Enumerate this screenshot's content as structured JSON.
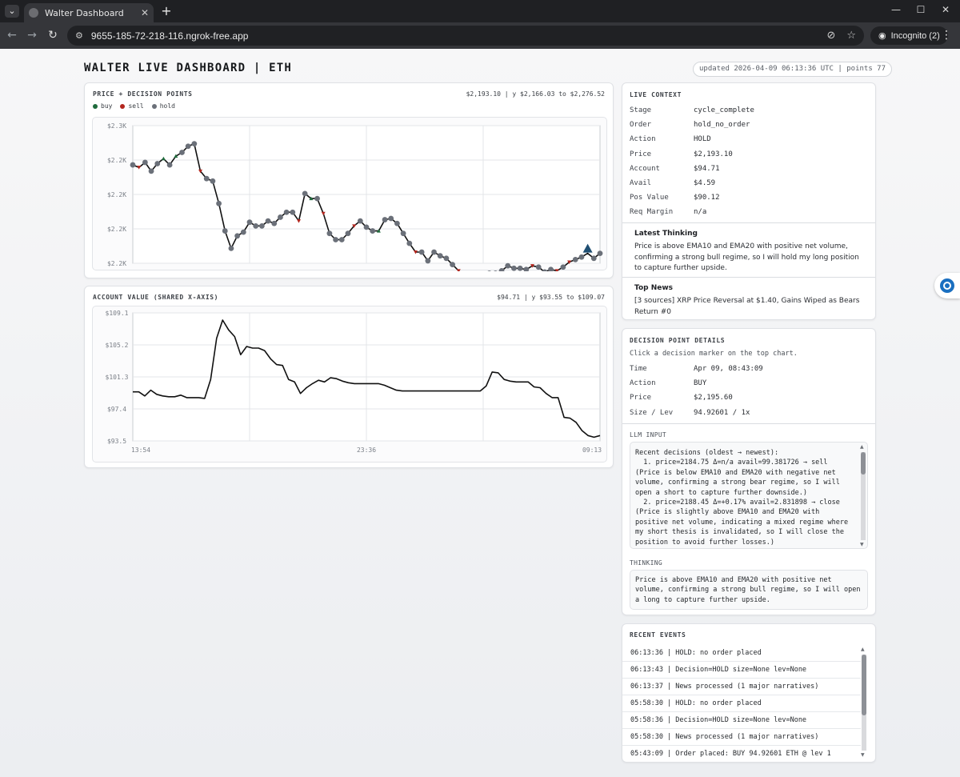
{
  "browser": {
    "tab_title": "Walter Dashboard",
    "url": "9655-185-72-218-116.ngrok-free.app",
    "incognito_label": "Incognito (2)"
  },
  "header": {
    "title": "WALTER LIVE DASHBOARD | ETH",
    "updated": "updated 2026-04-09 06:13:36 UTC | points 77"
  },
  "price_chart": {
    "title": "PRICE + DECISION POINTS",
    "range": "$2,193.10 | y $2,166.03 to $2,276.52",
    "legend": [
      {
        "label": "buy",
        "color": "#1f6b3c"
      },
      {
        "label": "sell",
        "color": "#b3261e"
      },
      {
        "label": "hold",
        "color": "#6b7079"
      }
    ],
    "y_ticks": [
      "$2.3K",
      "$2.2K",
      "$2.2K",
      "$2.2K",
      "$2.2K"
    ]
  },
  "account_chart": {
    "title": "ACCOUNT VALUE (SHARED X-AXIS)",
    "range": "$94.71 | y $93.55 to $109.07",
    "y_ticks": [
      "$109.1",
      "$105.2",
      "$101.3",
      "$97.4",
      "$93.5"
    ],
    "x_ticks": [
      "13:54",
      "23:36",
      "09:13"
    ]
  },
  "chart_data": [
    {
      "type": "line",
      "title": "PRICE + DECISION POINTS",
      "ylim": [
        2166.03,
        2276.52
      ],
      "y_tick_labels": [
        "$2.3K",
        "$2.2K",
        "$2.2K",
        "$2.2K",
        "$2.2K"
      ],
      "series": [
        {
          "name": "price",
          "values": [
            2245,
            2243,
            2247,
            2240,
            2246,
            2250,
            2245,
            2252,
            2255,
            2260,
            2262,
            2240,
            2234,
            2232,
            2214,
            2192,
            2178,
            2188,
            2191,
            2199,
            2196,
            2196,
            2200,
            2198,
            2203,
            2207,
            2207,
            2200,
            2222,
            2218,
            2218,
            2206,
            2190,
            2185,
            2185,
            2190,
            2196,
            2200,
            2195,
            2192,
            2192,
            2201,
            2202,
            2198,
            2190,
            2182,
            2175,
            2175,
            2168,
            2175,
            2172,
            2170,
            2165,
            2160,
            2150,
            2145,
            2152,
            2156,
            2158,
            2158,
            2160,
            2164,
            2162,
            2162,
            2161,
            2164,
            2163,
            2159,
            2161,
            2160,
            2163,
            2167,
            2169,
            2171,
            2174,
            2170,
            2174
          ]
        }
      ],
      "decisions": [
        {
          "index": 1,
          "action": "sell"
        },
        {
          "index": 5,
          "action": "buy"
        },
        {
          "index": 7,
          "action": "buy"
        },
        {
          "index": 11,
          "action": "sell"
        },
        {
          "index": 27,
          "action": "sell"
        },
        {
          "index": 29,
          "action": "buy"
        },
        {
          "index": 31,
          "action": "sell"
        },
        {
          "index": 36,
          "action": "sell"
        },
        {
          "index": 40,
          "action": "buy"
        },
        {
          "index": 46,
          "action": "sell"
        },
        {
          "index": 53,
          "action": "sell"
        },
        {
          "index": 65,
          "action": "sell"
        },
        {
          "index": 69,
          "action": "sell"
        },
        {
          "index": 71,
          "action": "sell"
        },
        {
          "index": 74,
          "action": "buy"
        }
      ],
      "grid": true
    },
    {
      "type": "line",
      "title": "ACCOUNT VALUE (SHARED X-AXIS)",
      "ylim": [
        93.55,
        109.07
      ],
      "y_tick_labels": [
        "$109.1",
        "$105.2",
        "$101.3",
        "$97.4",
        "$93.5"
      ],
      "x_tick_labels": [
        "13:54",
        "23:36",
        "09:13"
      ],
      "series": [
        {
          "name": "account",
          "values": [
            99.5,
            99.5,
            99.0,
            99.7,
            99.2,
            99.0,
            98.9,
            98.9,
            99.1,
            98.8,
            98.8,
            98.8,
            98.7,
            101.0,
            106.0,
            108.2,
            107.0,
            106.2,
            104.0,
            105.0,
            104.8,
            104.8,
            104.5,
            103.5,
            102.8,
            102.7,
            101.0,
            100.7,
            99.3,
            100.0,
            100.5,
            100.9,
            100.7,
            101.2,
            101.1,
            100.8,
            100.6,
            100.5,
            100.5,
            100.5,
            100.5,
            100.5,
            100.3,
            100.0,
            99.7,
            99.6,
            99.6,
            99.6,
            99.6,
            99.6,
            99.6,
            99.6,
            99.6,
            99.6,
            99.6,
            99.6,
            99.6,
            99.6,
            99.6,
            100.2,
            101.9,
            101.8,
            101.0,
            100.8,
            100.7,
            100.7,
            100.7,
            100.1,
            100.0,
            99.3,
            98.8,
            98.8,
            96.4,
            96.3,
            95.8,
            94.8,
            94.2,
            94.0,
            94.2
          ]
        }
      ],
      "grid": true
    }
  ],
  "live_context": {
    "title": "LIVE CONTEXT",
    "rows": [
      {
        "k": "Stage",
        "v": "cycle_complete"
      },
      {
        "k": "Order",
        "v": "hold_no_order"
      },
      {
        "k": "Action",
        "v": "HOLD"
      },
      {
        "k": "Price",
        "v": "$2,193.10"
      },
      {
        "k": "Account",
        "v": "$94.71"
      },
      {
        "k": "Avail",
        "v": "$4.59"
      },
      {
        "k": "Pos Value",
        "v": "$90.12"
      },
      {
        "k": "Req Margin",
        "v": "n/a"
      }
    ],
    "thinking_title": "Latest Thinking",
    "thinking": "Price is above EMA10 and EMA20 with positive net volume, confirming a strong bull regime, so I will hold my long position to capture further upside.",
    "news_title": "Top News",
    "news": "[3 sources] XRP Price Reversal at $1.40, Gains Wiped as Bears Return #0"
  },
  "decision": {
    "title": "DECISION POINT DETAILS",
    "hint": "Click a decision marker on the top chart.",
    "rows": [
      {
        "k": "Time",
        "v": "Apr 09, 08:43:09"
      },
      {
        "k": "Action",
        "v": "BUY"
      },
      {
        "k": "Price",
        "v": "$2,195.60"
      },
      {
        "k": "Size / Lev",
        "v": "94.92601 / 1x"
      }
    ],
    "llm_label": "LLM INPUT",
    "llm_input": "Recent decisions (oldest → newest):\n  1. price=2184.75 Δ=n/a avail=99.381726 → sell (Price is below EMA10 and EMA20 with negative net volume, confirming a strong bear regime, so I will open a short to capture further downside.)\n  2. price=2188.45 Δ=+0.17% avail=2.831898 → close (Price is slightly above EMA10 and EMA20 with positive net volume, indicating a mixed regime where my short thesis is invalidated, so I will close the position to avoid further losses.)",
    "thinking_label": "THINKING",
    "thinking": "Price is above EMA10 and EMA20 with positive net volume, confirming a strong bull regime, so I will open a long to capture further upside."
  },
  "events": {
    "title": "RECENT EVENTS",
    "items": [
      "06:13:36 | HOLD: no order placed",
      "06:13:43 | Decision=HOLD size=None lev=None",
      "06:13:37 | News processed (1 major narratives)",
      "05:58:30 | HOLD: no order placed",
      "05:58:36 | Decision=HOLD size=None lev=None",
      "05:58:30 | News processed (1 major narratives)",
      "05:43:09 | Order placed: BUY 94.92601 ETH @ lev 1"
    ]
  }
}
